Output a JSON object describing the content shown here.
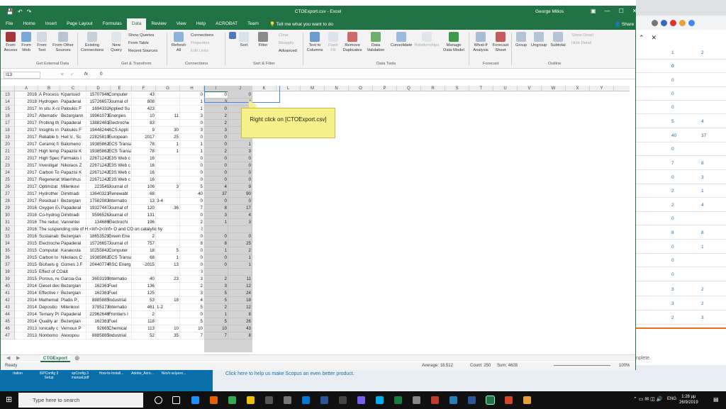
{
  "window_title": "CTOExport.csv - Excel",
  "user": "George Milios",
  "menu_tabs": [
    "File",
    "Home",
    "Insert",
    "Page Layout",
    "Formulas",
    "Data",
    "Review",
    "View",
    "Help",
    "ACROBAT",
    "Team"
  ],
  "tell_me": "Tell me what you want to do",
  "share": "Share",
  "ribbon": {
    "from_access": "From Access",
    "from_web": "From Web",
    "from_text": "From Text",
    "from_other": "From Other Sources",
    "existing": "Existing Connections",
    "new_query": "New Query",
    "show_queries": "Show Queries",
    "from_table": "From Table",
    "recent_sources": "Recent Sources",
    "refresh_all": "Refresh All",
    "connections": "Connections",
    "properties": "Properties",
    "edit_links": "Edit Links",
    "sort": "Sort",
    "filter": "Filter",
    "clear": "Clear",
    "reapply": "Reapply",
    "advanced": "Advanced",
    "text_to_columns": "Text to Columns",
    "flash_fill": "Flash Fill",
    "remove_duplicates": "Remove Duplicates",
    "data_validation": "Data Validation",
    "consolidate": "Consolidate",
    "relationships": "Relationships",
    "manage_data_model": "Manage Data Model",
    "what_if": "What-If Analysis",
    "forecast_sheet": "Forecast Sheet",
    "group": "Group",
    "ungroup": "Ungroup",
    "subtotal": "Subtotal",
    "show_detail": "Show Detail",
    "hide_detail": "Hide Detail",
    "groups": [
      "Get External Data",
      "Get & Transform",
      "Connections",
      "Sort & Filter",
      "Data Tools",
      "Forecast",
      "Outline"
    ]
  },
  "name_box": "I13",
  "fx": "fx",
  "formula_value": "0",
  "columns": [
    "A",
    "B",
    "C",
    "D",
    "E",
    "F",
    "G",
    "H",
    "I",
    "J",
    "K",
    "L",
    "M",
    "N",
    "O",
    "P",
    "Q",
    "R",
    "S",
    "T",
    "U",
    "V",
    "W",
    "X",
    "Y"
  ],
  "rows": [
    {
      "n": "13",
      "a": "2018",
      "b": "A Process",
      "c": "Kiparissid",
      "d": "15707946",
      "e": "Computer",
      "f": "43",
      "g": "",
      "h": "0",
      "i": "0",
      "j": "0"
    },
    {
      "n": "14",
      "a": "2018",
      "b": "Hydrogen",
      "c": "Papaderal",
      "d": "15726657",
      "e": "Journal of",
      "f": "808",
      "g": "",
      "h": "1",
      "i": "3",
      "j": "4"
    },
    {
      "n": "15",
      "a": "2017",
      "b": "In situ X-ra",
      "c": "Paloukis F",
      "d": "1694332",
      "e": "Applied Su",
      "f": "423",
      "g": "",
      "h": "1",
      "i": "0",
      "j": "1"
    },
    {
      "n": "16",
      "a": "2017",
      "b": "Alternativ",
      "c": "Bezergiann",
      "d": "19961073",
      "e": "Energies",
      "f": "10",
      "g": "11",
      "h": "3",
      "i": "2",
      "j": "2"
    },
    {
      "n": "17",
      "a": "2017",
      "b": "Probing th",
      "c": "Papaderal",
      "d": "13882481",
      "e": "Electroche",
      "f": "83",
      "g": "",
      "h": "0",
      "i": "2",
      "j": "2"
    },
    {
      "n": "18",
      "a": "2017",
      "b": "Insights in",
      "c": "Paloukis F",
      "d": "19448244",
      "e": "ACS Appli",
      "f": "9",
      "g": "30",
      "h": "3",
      "i": "3",
      "j": "0"
    },
    {
      "n": "19",
      "a": "2017",
      "b": "Reliable b",
      "c": "Heil V., Sc",
      "d": "22825819",
      "e": "European",
      "f": "2017",
      "g": "25",
      "h": "0",
      "i": "0",
      "j": "0"
    },
    {
      "n": "20",
      "a": "2017",
      "b": "Ceramic fi",
      "c": "Balomeno",
      "d": "19385862",
      "e": "ECS Transa",
      "f": "78",
      "g": "1",
      "h": "1",
      "i": "0",
      "j": "1"
    },
    {
      "n": "21",
      "a": "2017",
      "b": "High temp",
      "c": "Papazisi K",
      "d": "19385862",
      "e": "ECS Transa",
      "f": "78",
      "g": "1",
      "h": "1",
      "i": "2",
      "j": "3"
    },
    {
      "n": "22",
      "a": "2017",
      "b": "High Spec",
      "c": "Farmakis I",
      "d": "22671242",
      "e": "E3S Web c",
      "f": "16",
      "g": "",
      "h": "0",
      "i": "0",
      "j": "0"
    },
    {
      "n": "23",
      "a": "2017",
      "b": "Investigat",
      "c": "Nikolaos Z",
      "d": "22671242",
      "e": "E3S Web c",
      "f": "16",
      "g": "",
      "h": "0",
      "i": "0",
      "j": "0"
    },
    {
      "n": "24",
      "a": "2017",
      "b": "Carbon To",
      "c": "Papazisi K",
      "d": "22671242",
      "e": "E3S Web c",
      "f": "16",
      "g": "",
      "h": "0",
      "i": "0",
      "j": "0"
    },
    {
      "n": "25",
      "a": "2017",
      "b": "Regenerat",
      "c": "Waernhus",
      "d": "22671242",
      "e": "E3S Web c",
      "f": "16",
      "g": "",
      "h": "0",
      "i": "0",
      "j": "0"
    },
    {
      "n": "26",
      "a": "2017",
      "b": "Optimizat",
      "c": "Milenkovi",
      "d": "223549",
      "e": "Journal of",
      "f": "106",
      "g": "3",
      "h": "5",
      "i": "4",
      "j": "9"
    },
    {
      "n": "27",
      "a": "2017",
      "b": "Hydrother",
      "c": "Dimitriadi",
      "d": "13640321",
      "e": "Renewabl",
      "f": "68",
      "g": "",
      "h": "40",
      "i": "37",
      "j": "90"
    },
    {
      "n": "28",
      "a": "2017",
      "b": "Residual I",
      "c": "Bezergian",
      "d": "17582083",
      "e": "Internatio",
      "f": "13",
      "g": "3-4",
      "h": "0",
      "i": "0",
      "j": "0"
    },
    {
      "n": "29",
      "a": "2016",
      "b": "Oxygen Ev",
      "c": "Papaderal",
      "d": "19327447",
      "e": "Journal of",
      "f": "120",
      "g": "36",
      "h": "7",
      "i": "8",
      "j": "17"
    },
    {
      "n": "30",
      "a": "2016",
      "b": "Co-hydrog",
      "c": "Dimitriadi",
      "d": "9596526",
      "e": "Journal of",
      "f": "131",
      "g": "",
      "h": "0",
      "i": "3",
      "j": "4"
    },
    {
      "n": "31",
      "a": "2016",
      "b": "The reduc",
      "c": "Vanrentei",
      "d": "134686",
      "e": "Electrochi",
      "f": "196",
      "g": "",
      "h": "2",
      "i": "1",
      "j": "3"
    },
    {
      "n": "32",
      "a": "2016",
      "b": "The suspending role of H <inf>2</inf> O and CO on catalytic hy",
      "c": "",
      "d": "",
      "e": "",
      "f": "",
      "g": "",
      "h": "2",
      "i": "",
      "j": ""
    },
    {
      "n": "33",
      "a": "2016",
      "b": "Sustainab",
      "c": "Bezergian",
      "d": "18653529",
      "e": "Green Ene",
      "f": "2",
      "g": "",
      "h": "0",
      "i": "0",
      "j": "0"
    },
    {
      "n": "34",
      "a": "2015",
      "b": "Electroche",
      "c": "Papaderal",
      "d": "15726657",
      "e": "Journal of",
      "f": "757",
      "g": "",
      "h": "8",
      "i": "8",
      "j": "25"
    },
    {
      "n": "35",
      "a": "2015",
      "b": "Computat",
      "c": "Karakosta",
      "d": "10255842",
      "e": "Computer",
      "f": "18",
      "g": "5",
      "h": "0",
      "i": "1",
      "j": "2"
    },
    {
      "n": "36",
      "a": "2015",
      "b": "Carbon to",
      "c": "Nikolaos C",
      "d": "19385862",
      "e": "ECS Transa",
      "f": "68",
      "g": "1",
      "h": "0",
      "i": "0",
      "j": "1"
    },
    {
      "n": "37",
      "a": "2015",
      "b": "Biofuels g",
      "c": "Gomes J.F",
      "d": "20440774",
      "e": "RSC Energ",
      "f": "-2015",
      "g": "13",
      "h": "0",
      "i": "0",
      "j": "1"
    },
    {
      "n": "38",
      "a": "2015",
      "b": "Effect of CO&lt",
      "c": "",
      "d": "",
      "e": "",
      "f": "",
      "g": "",
      "h": "3",
      "i": "",
      "j": ""
    },
    {
      "n": "39",
      "a": "2015",
      "b": "Porous, re",
      "c": "Garcia-Ga",
      "d": "3603199",
      "e": "Internatio",
      "f": "40",
      "g": "23",
      "h": "3",
      "i": "2",
      "j": "11"
    },
    {
      "n": "40",
      "a": "2014",
      "b": "Diesel dec",
      "c": "Bezergian",
      "d": "162361",
      "e": "Fuel",
      "f": "136",
      "g": "",
      "h": "2",
      "i": "3",
      "j": "12"
    },
    {
      "n": "41",
      "a": "2014",
      "b": "Effective r",
      "c": "Bezergian",
      "d": "162361",
      "e": "Fuel",
      "f": "125",
      "g": "",
      "h": "3",
      "i": "5",
      "j": "24"
    },
    {
      "n": "42",
      "a": "2014",
      "b": "Mathemat",
      "c": "Pladis P.,",
      "d": "8885885",
      "e": "Industrial",
      "f": "53",
      "g": "18",
      "h": "4",
      "i": "5",
      "j": "18"
    },
    {
      "n": "43",
      "a": "2014",
      "b": "Depositio",
      "c": "Milenkovi",
      "d": "3785173",
      "e": "Internatio",
      "f": "461",
      "g": "1-2",
      "h": "5",
      "i": "2",
      "j": "12"
    },
    {
      "n": "44",
      "a": "2014",
      "b": "Ternary Pl",
      "c": "Papaderal",
      "d": "22962646",
      "e": "Frontiers I",
      "f": "2",
      "g": "",
      "h": "0",
      "i": "1",
      "j": "8"
    },
    {
      "n": "45",
      "a": "2014",
      "b": "Quality ar",
      "c": "Bezergian",
      "d": "162361",
      "e": "Fuel",
      "f": "118",
      "g": "",
      "h": "5",
      "i": "5",
      "j": "26"
    },
    {
      "n": "46",
      "a": "2013",
      "b": "Ionically c",
      "c": "Vernoux P",
      "d": "92665",
      "e": "Chemical",
      "f": "113",
      "g": "10",
      "h": "10",
      "i": "10",
      "j": "43"
    },
    {
      "n": "47",
      "a": "2013",
      "b": "Nonbomo",
      "c": "Alexopou",
      "d": "8885885",
      "e": "Industrial",
      "f": "52",
      "g": "35",
      "h": "7",
      "i": "7",
      "j": "8"
    }
  ],
  "callout": "Right click on [CTOExport.csv]",
  "sheet_tab": "CTOExport",
  "status": {
    "ready": "Ready",
    "average": "Average: 18.512",
    "count": "Count: 250",
    "sum": "Sum: 4628",
    "zoom": "100%"
  },
  "browser": {
    "rows": [
      [
        "0",
        ""
      ],
      [
        "1",
        "2"
      ],
      [
        "0",
        ""
      ],
      [
        "0",
        ""
      ],
      [
        "0",
        ""
      ],
      [
        "0",
        ""
      ],
      [
        "5",
        "4"
      ],
      [
        "40",
        "37"
      ],
      [
        "0",
        ""
      ],
      [
        "7",
        "8"
      ],
      [
        "0",
        "3"
      ],
      [
        "2",
        "1"
      ],
      [
        "2",
        "4"
      ],
      [
        "0",
        ""
      ],
      [
        "8",
        "8"
      ],
      [
        "0",
        "1"
      ],
      [
        "0",
        ""
      ],
      [
        "0",
        ""
      ],
      [
        "3",
        "2"
      ],
      [
        "3",
        "2"
      ],
      [
        "2",
        "3"
      ]
    ],
    "complete": "nplete.",
    "footer_link": "Click here to help us make Scopus an even better product."
  },
  "desktop_icons": [
    "rtation",
    "ISPConfig 3 Setup",
    "spConfig 3 manual.pdf",
    "How-to-Install...",
    "Adobe_Acro...",
    "Νέο/ο κείμενο..."
  ],
  "taskbar": {
    "search": "Type here to search",
    "time": "1:28 μμ",
    "date": "26/9/2019",
    "lang": "ENG"
  }
}
